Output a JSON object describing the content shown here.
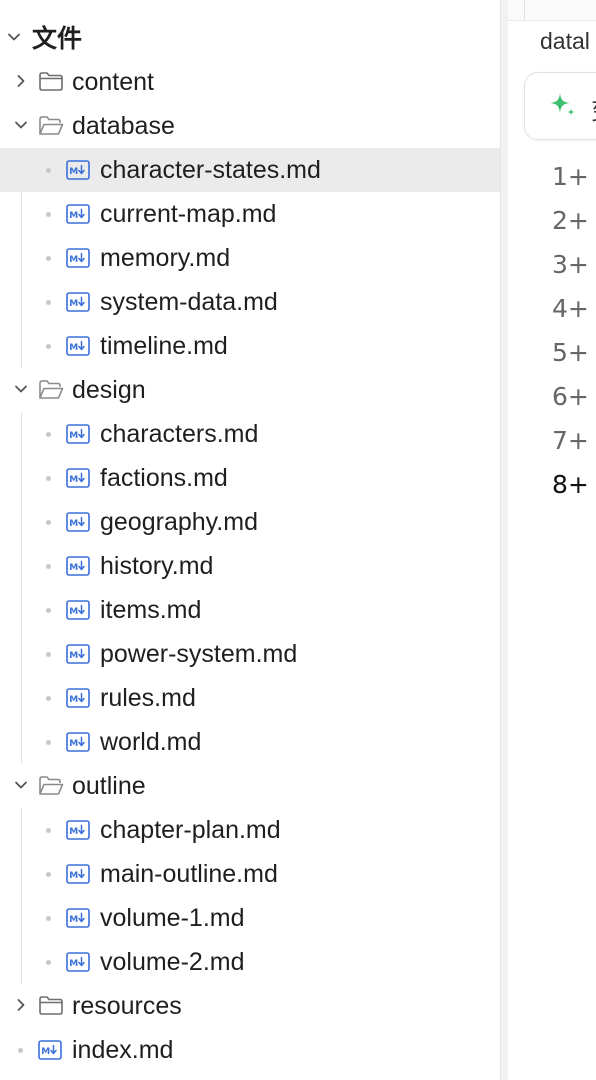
{
  "explorer": {
    "root_label": "文件",
    "rows": [
      {
        "label": "content",
        "kind": "folder",
        "expanded": false
      },
      {
        "label": "database",
        "kind": "folder",
        "expanded": true
      },
      {
        "label": "character-states.md",
        "kind": "file",
        "selected": true
      },
      {
        "label": "current-map.md",
        "kind": "file"
      },
      {
        "label": "memory.md",
        "kind": "file"
      },
      {
        "label": "system-data.md",
        "kind": "file"
      },
      {
        "label": "timeline.md",
        "kind": "file"
      },
      {
        "label": "design",
        "kind": "folder",
        "expanded": true
      },
      {
        "label": "characters.md",
        "kind": "file"
      },
      {
        "label": "factions.md",
        "kind": "file"
      },
      {
        "label": "geography.md",
        "kind": "file"
      },
      {
        "label": "history.md",
        "kind": "file"
      },
      {
        "label": "items.md",
        "kind": "file"
      },
      {
        "label": "power-system.md",
        "kind": "file"
      },
      {
        "label": "rules.md",
        "kind": "file"
      },
      {
        "label": "world.md",
        "kind": "file"
      },
      {
        "label": "outline",
        "kind": "folder",
        "expanded": true
      },
      {
        "label": "chapter-plan.md",
        "kind": "file"
      },
      {
        "label": "main-outline.md",
        "kind": "file"
      },
      {
        "label": "volume-1.md",
        "kind": "file"
      },
      {
        "label": "volume-2.md",
        "kind": "file"
      },
      {
        "label": "resources",
        "kind": "folder",
        "expanded": false
      },
      {
        "label": "index.md",
        "kind": "file"
      }
    ]
  },
  "editor": {
    "tab_title": "datal",
    "ai_button_label": "变",
    "line_numbers": [
      "1+",
      "2+",
      "3+",
      "4+",
      "5+",
      "6+",
      "7+",
      "8+"
    ]
  },
  "colors": {
    "selected_row": "#ebebec",
    "md_icon": "#3b6fd9",
    "sparkle": "#3cbf6e",
    "divider": "#f2f2f2"
  },
  "icons": {
    "chevron_right": "chevron-right-icon",
    "chevron_down": "chevron-down-icon",
    "folder_closed": "folder-icon",
    "folder_open": "folder-open-icon",
    "markdown_file": "markdown-file-icon",
    "sparkle": "sparkle-icon"
  }
}
